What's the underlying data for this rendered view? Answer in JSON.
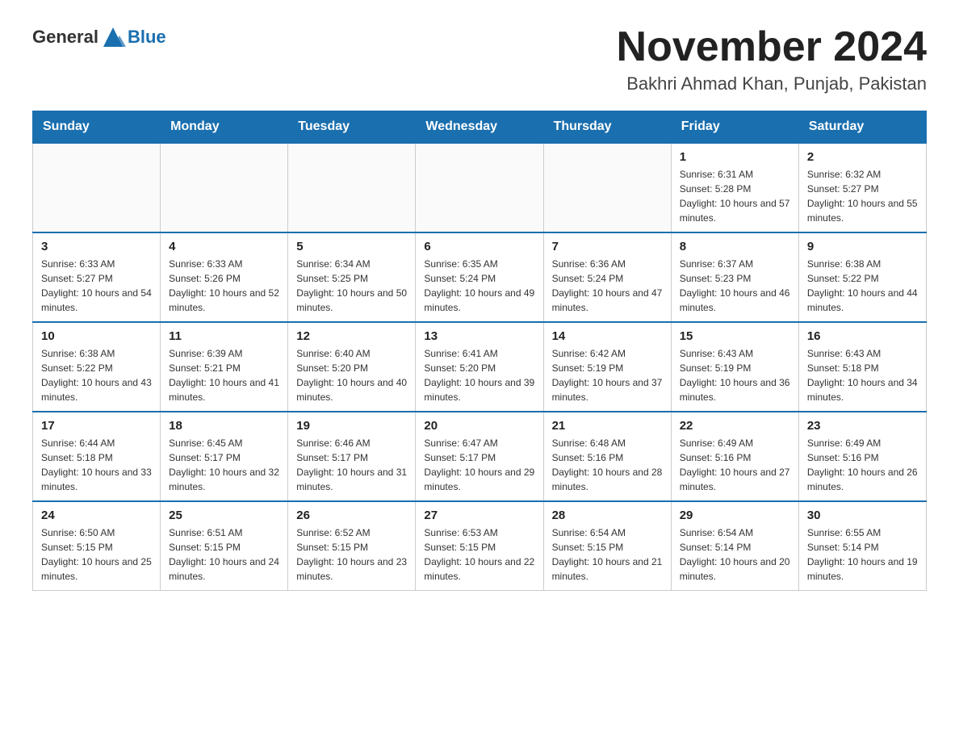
{
  "header": {
    "logo_general": "General",
    "logo_blue": "Blue",
    "month_title": "November 2024",
    "location": "Bakhri Ahmad Khan, Punjab, Pakistan"
  },
  "days_of_week": [
    "Sunday",
    "Monday",
    "Tuesday",
    "Wednesday",
    "Thursday",
    "Friday",
    "Saturday"
  ],
  "weeks": [
    {
      "days": [
        {
          "number": "",
          "sunrise": "",
          "sunset": "",
          "daylight": ""
        },
        {
          "number": "",
          "sunrise": "",
          "sunset": "",
          "daylight": ""
        },
        {
          "number": "",
          "sunrise": "",
          "sunset": "",
          "daylight": ""
        },
        {
          "number": "",
          "sunrise": "",
          "sunset": "",
          "daylight": ""
        },
        {
          "number": "",
          "sunrise": "",
          "sunset": "",
          "daylight": ""
        },
        {
          "number": "1",
          "sunrise": "Sunrise: 6:31 AM",
          "sunset": "Sunset: 5:28 PM",
          "daylight": "Daylight: 10 hours and 57 minutes."
        },
        {
          "number": "2",
          "sunrise": "Sunrise: 6:32 AM",
          "sunset": "Sunset: 5:27 PM",
          "daylight": "Daylight: 10 hours and 55 minutes."
        }
      ]
    },
    {
      "days": [
        {
          "number": "3",
          "sunrise": "Sunrise: 6:33 AM",
          "sunset": "Sunset: 5:27 PM",
          "daylight": "Daylight: 10 hours and 54 minutes."
        },
        {
          "number": "4",
          "sunrise": "Sunrise: 6:33 AM",
          "sunset": "Sunset: 5:26 PM",
          "daylight": "Daylight: 10 hours and 52 minutes."
        },
        {
          "number": "5",
          "sunrise": "Sunrise: 6:34 AM",
          "sunset": "Sunset: 5:25 PM",
          "daylight": "Daylight: 10 hours and 50 minutes."
        },
        {
          "number": "6",
          "sunrise": "Sunrise: 6:35 AM",
          "sunset": "Sunset: 5:24 PM",
          "daylight": "Daylight: 10 hours and 49 minutes."
        },
        {
          "number": "7",
          "sunrise": "Sunrise: 6:36 AM",
          "sunset": "Sunset: 5:24 PM",
          "daylight": "Daylight: 10 hours and 47 minutes."
        },
        {
          "number": "8",
          "sunrise": "Sunrise: 6:37 AM",
          "sunset": "Sunset: 5:23 PM",
          "daylight": "Daylight: 10 hours and 46 minutes."
        },
        {
          "number": "9",
          "sunrise": "Sunrise: 6:38 AM",
          "sunset": "Sunset: 5:22 PM",
          "daylight": "Daylight: 10 hours and 44 minutes."
        }
      ]
    },
    {
      "days": [
        {
          "number": "10",
          "sunrise": "Sunrise: 6:38 AM",
          "sunset": "Sunset: 5:22 PM",
          "daylight": "Daylight: 10 hours and 43 minutes."
        },
        {
          "number": "11",
          "sunrise": "Sunrise: 6:39 AM",
          "sunset": "Sunset: 5:21 PM",
          "daylight": "Daylight: 10 hours and 41 minutes."
        },
        {
          "number": "12",
          "sunrise": "Sunrise: 6:40 AM",
          "sunset": "Sunset: 5:20 PM",
          "daylight": "Daylight: 10 hours and 40 minutes."
        },
        {
          "number": "13",
          "sunrise": "Sunrise: 6:41 AM",
          "sunset": "Sunset: 5:20 PM",
          "daylight": "Daylight: 10 hours and 39 minutes."
        },
        {
          "number": "14",
          "sunrise": "Sunrise: 6:42 AM",
          "sunset": "Sunset: 5:19 PM",
          "daylight": "Daylight: 10 hours and 37 minutes."
        },
        {
          "number": "15",
          "sunrise": "Sunrise: 6:43 AM",
          "sunset": "Sunset: 5:19 PM",
          "daylight": "Daylight: 10 hours and 36 minutes."
        },
        {
          "number": "16",
          "sunrise": "Sunrise: 6:43 AM",
          "sunset": "Sunset: 5:18 PM",
          "daylight": "Daylight: 10 hours and 34 minutes."
        }
      ]
    },
    {
      "days": [
        {
          "number": "17",
          "sunrise": "Sunrise: 6:44 AM",
          "sunset": "Sunset: 5:18 PM",
          "daylight": "Daylight: 10 hours and 33 minutes."
        },
        {
          "number": "18",
          "sunrise": "Sunrise: 6:45 AM",
          "sunset": "Sunset: 5:17 PM",
          "daylight": "Daylight: 10 hours and 32 minutes."
        },
        {
          "number": "19",
          "sunrise": "Sunrise: 6:46 AM",
          "sunset": "Sunset: 5:17 PM",
          "daylight": "Daylight: 10 hours and 31 minutes."
        },
        {
          "number": "20",
          "sunrise": "Sunrise: 6:47 AM",
          "sunset": "Sunset: 5:17 PM",
          "daylight": "Daylight: 10 hours and 29 minutes."
        },
        {
          "number": "21",
          "sunrise": "Sunrise: 6:48 AM",
          "sunset": "Sunset: 5:16 PM",
          "daylight": "Daylight: 10 hours and 28 minutes."
        },
        {
          "number": "22",
          "sunrise": "Sunrise: 6:49 AM",
          "sunset": "Sunset: 5:16 PM",
          "daylight": "Daylight: 10 hours and 27 minutes."
        },
        {
          "number": "23",
          "sunrise": "Sunrise: 6:49 AM",
          "sunset": "Sunset: 5:16 PM",
          "daylight": "Daylight: 10 hours and 26 minutes."
        }
      ]
    },
    {
      "days": [
        {
          "number": "24",
          "sunrise": "Sunrise: 6:50 AM",
          "sunset": "Sunset: 5:15 PM",
          "daylight": "Daylight: 10 hours and 25 minutes."
        },
        {
          "number": "25",
          "sunrise": "Sunrise: 6:51 AM",
          "sunset": "Sunset: 5:15 PM",
          "daylight": "Daylight: 10 hours and 24 minutes."
        },
        {
          "number": "26",
          "sunrise": "Sunrise: 6:52 AM",
          "sunset": "Sunset: 5:15 PM",
          "daylight": "Daylight: 10 hours and 23 minutes."
        },
        {
          "number": "27",
          "sunrise": "Sunrise: 6:53 AM",
          "sunset": "Sunset: 5:15 PM",
          "daylight": "Daylight: 10 hours and 22 minutes."
        },
        {
          "number": "28",
          "sunrise": "Sunrise: 6:54 AM",
          "sunset": "Sunset: 5:15 PM",
          "daylight": "Daylight: 10 hours and 21 minutes."
        },
        {
          "number": "29",
          "sunrise": "Sunrise: 6:54 AM",
          "sunset": "Sunset: 5:14 PM",
          "daylight": "Daylight: 10 hours and 20 minutes."
        },
        {
          "number": "30",
          "sunrise": "Sunrise: 6:55 AM",
          "sunset": "Sunset: 5:14 PM",
          "daylight": "Daylight: 10 hours and 19 minutes."
        }
      ]
    }
  ]
}
